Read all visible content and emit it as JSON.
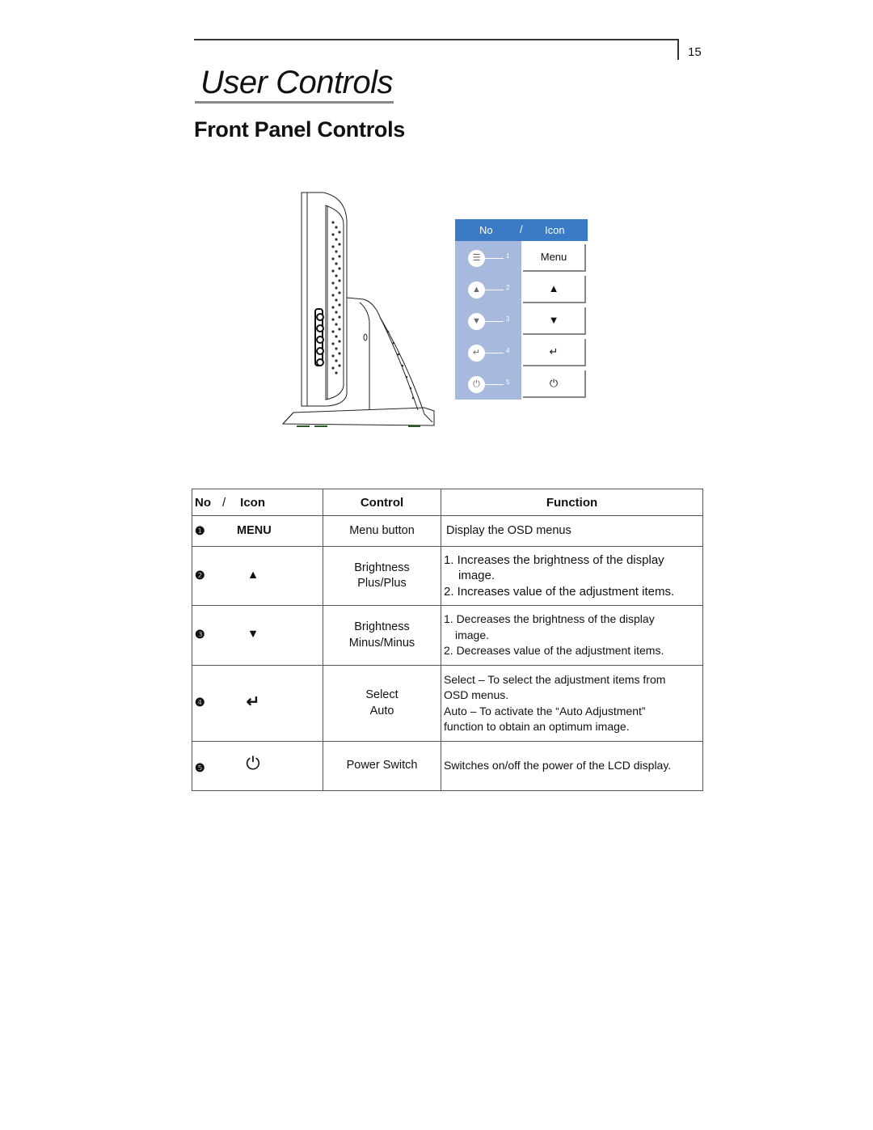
{
  "page": {
    "number": "15",
    "chapter_title": "User Controls",
    "section_title": "Front Panel Controls"
  },
  "illustration": {
    "name": "monitor-side-view",
    "legend": {
      "header_no": "No",
      "header_slash": "/",
      "header_icon": "Icon",
      "colors": {
        "header": "#3b7ac4",
        "panel": "#a8b9de"
      },
      "items": [
        {
          "num": "1",
          "icon": "menu-icon",
          "glyph": "☰",
          "label": "Menu"
        },
        {
          "num": "2",
          "icon": "up-triangle-icon",
          "glyph": "▲",
          "label": "▲"
        },
        {
          "num": "3",
          "icon": "down-triangle-icon",
          "glyph": "▼",
          "label": "▼"
        },
        {
          "num": "4",
          "icon": "enter-icon",
          "glyph": "↵",
          "label": "↵"
        },
        {
          "num": "5",
          "icon": "power-icon",
          "glyph": "⏻",
          "label": "⏻"
        }
      ]
    }
  },
  "table": {
    "headers": {
      "no": "No",
      "slash": "/",
      "icon": "Icon",
      "control": "Control",
      "function": "Function"
    },
    "rows": [
      {
        "num": "❶",
        "icon": "MENU",
        "control": [
          "Menu button"
        ],
        "function": [
          "Display the OSD menus"
        ]
      },
      {
        "num": "❷",
        "icon": "▲",
        "control": [
          "Brightness",
          "Plus/Plus"
        ],
        "function": [
          "1. Increases the brightness of the display",
          "    image.",
          "2. Increases value of the adjustment items."
        ]
      },
      {
        "num": "❸",
        "icon": "▼",
        "control": [
          "Brightness",
          "Minus/Minus"
        ],
        "function": [
          "1. Decreases the brightness of the display",
          "   image.",
          "2. Decreases value of the adjustment items."
        ]
      },
      {
        "num": "❹",
        "icon": "↵",
        "control": [
          "Select",
          "Auto"
        ],
        "function": [
          "Select – To select the adjustment items from",
          "OSD menus.",
          "Auto – To activate the “Auto Adjustment”",
          "function to obtain an optimum image."
        ]
      },
      {
        "num": "❺",
        "icon": "⏻",
        "control": [
          "Power Switch"
        ],
        "function": [
          "Switches on/off the power of the LCD display."
        ]
      }
    ]
  }
}
